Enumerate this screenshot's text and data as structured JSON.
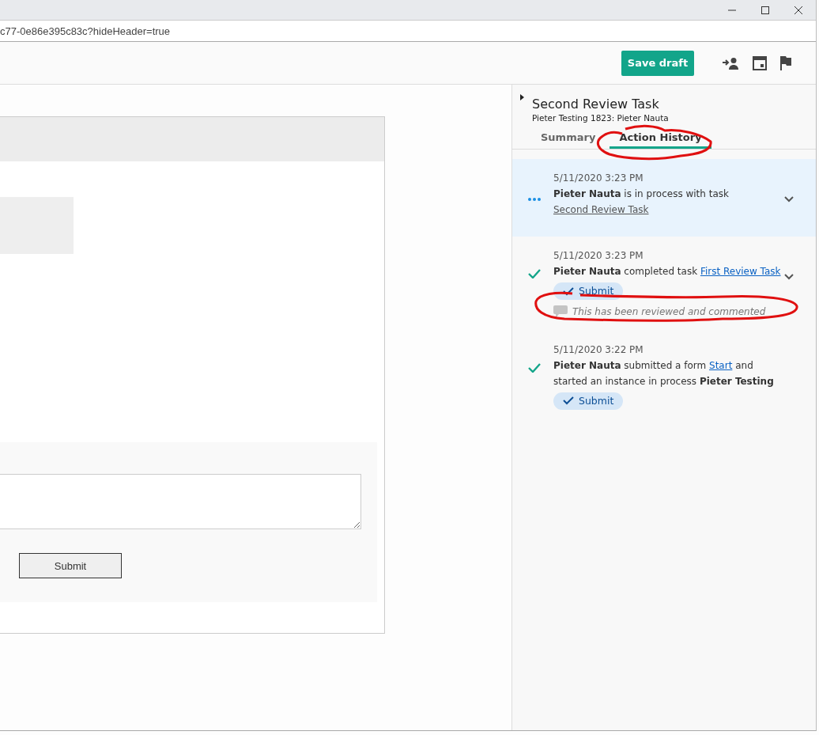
{
  "address_bar": {
    "url": "c77-0e86e395c83c?hideHeader=true"
  },
  "toolbar": {
    "save_button": "Save draft"
  },
  "form": {
    "submit_button": "Submit"
  },
  "task_panel": {
    "title": "Second Review Task",
    "subtitle": "Pieter Testing 1823: Pieter Nauta",
    "tabs": [
      {
        "label": "Summary",
        "selected": false
      },
      {
        "label": "Action History",
        "selected": true
      }
    ],
    "history": [
      {
        "kind": "in_process",
        "highlighted": true,
        "expandable": true,
        "timestamp": "5/11/2020 3:23 PM",
        "before": "**Pieter Nauta** is in process with task",
        "link": "Second Review Task"
      },
      {
        "kind": "completed",
        "highlighted": false,
        "expandable": true,
        "timestamp": "5/11/2020 3:23 PM",
        "before": "**Pieter Nauta** completed task",
        "link": "First Review Task",
        "action": "Submit",
        "comment": "This has been reviewed and commented"
      },
      {
        "kind": "completed",
        "highlighted": false,
        "expandable": false,
        "timestamp": "5/11/2020 3:22 PM",
        "before": "**Pieter Nauta** submitted a form",
        "link": "Start",
        "after": "and started an instance in process **Pieter Testing**",
        "action": "Submit"
      }
    ]
  }
}
